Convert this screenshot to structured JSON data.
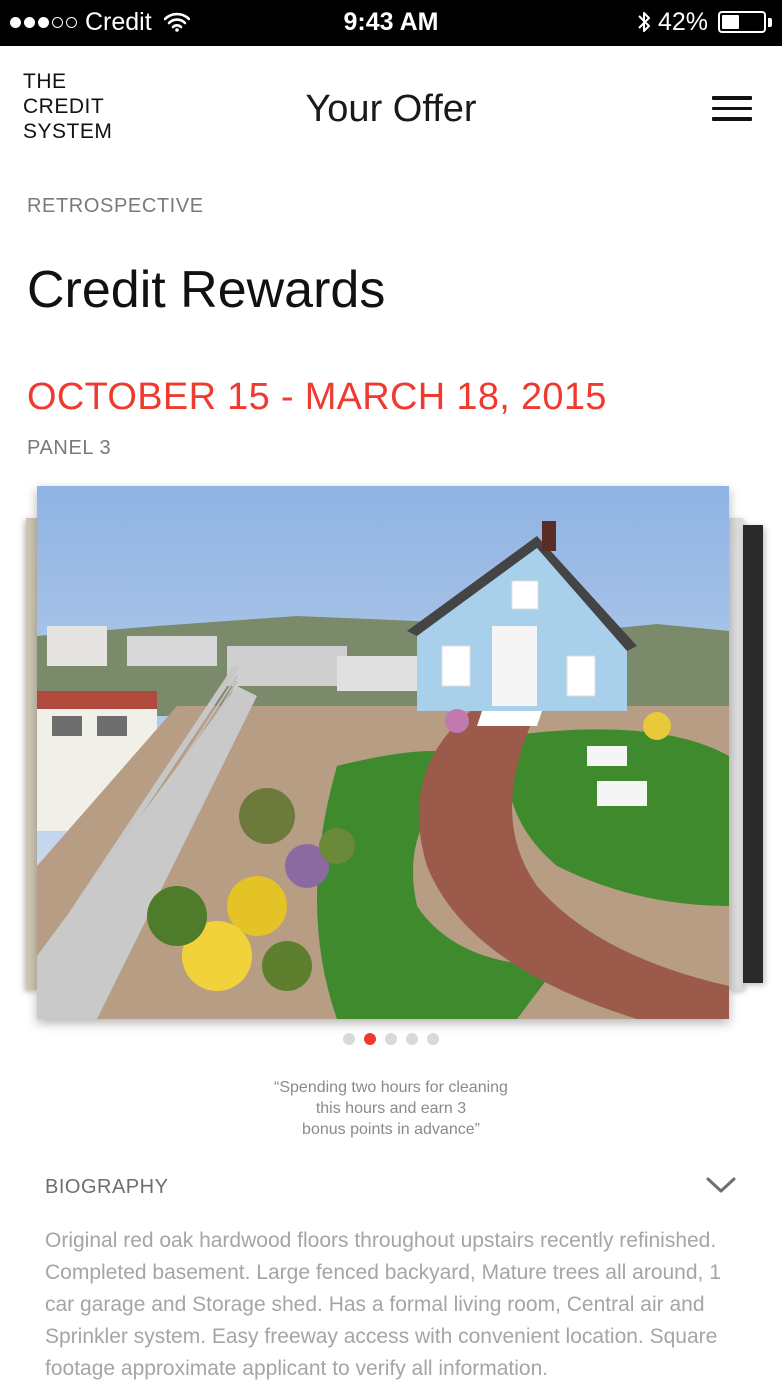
{
  "status_bar": {
    "carrier": "Credit",
    "time": "9:43 AM",
    "battery_percent": "42%",
    "battery_level": 0.42,
    "signal_filled": 3,
    "signal_total": 5,
    "icons": [
      "wifi-icon",
      "bluetooth-icon",
      "battery-icon"
    ]
  },
  "header": {
    "logo_line1": "THE",
    "logo_line2": "CREDIT",
    "logo_line3": "SYSTEM",
    "title": "Your Offer",
    "menu_icon": "hamburger-menu-icon"
  },
  "content": {
    "eyebrow": "RETROSPECTIVE",
    "headline": "Credit Rewards",
    "date_range": "OCTOBER 15 - MARCH 18, 2015",
    "panel_label": "PANEL 3",
    "carousel": {
      "total_slides": 5,
      "active_index": 1
    },
    "quote_line1": "“Spending two hours for cleaning",
    "quote_line2": "this hours and earn 3",
    "quote_line3": "bonus points in advance”",
    "biography": {
      "title": "BIOGRAPHY",
      "chevron_icon": "chevron-down-icon",
      "text": "Original red oak hardwood floors throughout upstairs recently refinished. Completed basement. Large fenced backyard, Mature trees all around, 1 car garage and Storage shed. Has a formal living room, Central air and Sprinkler system. Easy freeway access with convenient location. Square footage approximate applicant to verify all information."
    }
  },
  "colors": {
    "accent": "#ef3b2f",
    "muted_text": "#7a7a7a",
    "status_bar": "#000000"
  }
}
